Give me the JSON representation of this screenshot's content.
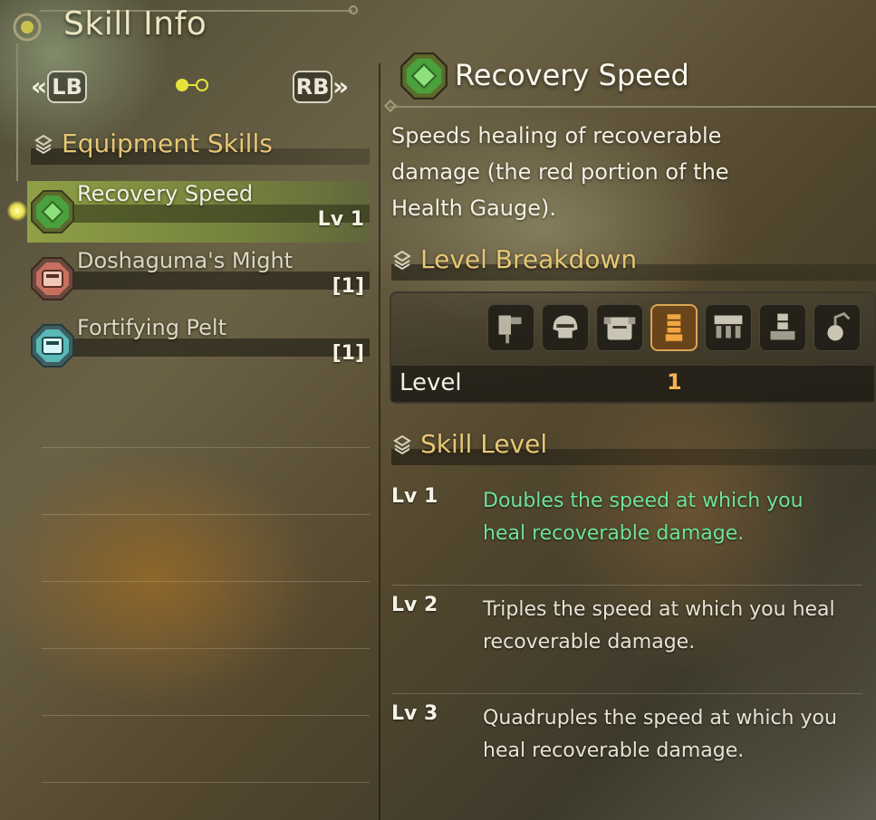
{
  "header": {
    "title": "Skill Info"
  },
  "nav": {
    "prev_label": "LB",
    "next_label": "RB"
  },
  "equipment_skills": {
    "heading": "Equipment Skills",
    "items": [
      {
        "name": "Recovery Speed",
        "level": "Lv 1",
        "selected": true,
        "icon": "green-gem-icon",
        "color": "#4aa03c"
      },
      {
        "name": "Doshaguma's Might",
        "level": "[1]",
        "selected": false,
        "icon": "doshaguma-crest-icon",
        "color": "#c77060"
      },
      {
        "name": "Fortifying Pelt",
        "level": "[1]",
        "selected": false,
        "icon": "pelt-crest-icon",
        "color": "#5ab8b8"
      }
    ]
  },
  "detail": {
    "skill_name": "Recovery Speed",
    "description": "Speeds healing of recoverable damage (the red portion of the Health Gauge).",
    "breakdown": {
      "heading": "Level Breakdown",
      "slots": [
        {
          "icon": "weapon-icon",
          "active": false
        },
        {
          "icon": "helm-icon",
          "active": false
        },
        {
          "icon": "chest-icon",
          "active": false
        },
        {
          "icon": "arms-icon",
          "active": true
        },
        {
          "icon": "waist-icon",
          "active": false
        },
        {
          "icon": "legs-icon",
          "active": false
        },
        {
          "icon": "talisman-icon",
          "active": false
        }
      ],
      "row_label": "Level",
      "row_value": "1"
    },
    "skill_level": {
      "heading": "Skill Level",
      "levels": [
        {
          "tag": "Lv 1",
          "text": "Doubles the speed at which you heal recoverable damage.",
          "active": true
        },
        {
          "tag": "Lv 2",
          "text": "Triples the speed at which you heal recoverable damage.",
          "active": false
        },
        {
          "tag": "Lv 3",
          "text": "Quadruples the speed at which you heal recoverable damage.",
          "active": false
        }
      ]
    }
  },
  "colors": {
    "accent_gold": "#e6c774",
    "active_green": "#6ee39a",
    "level_orange": "#f0b350",
    "selection_yellow": "#e6e23a"
  }
}
